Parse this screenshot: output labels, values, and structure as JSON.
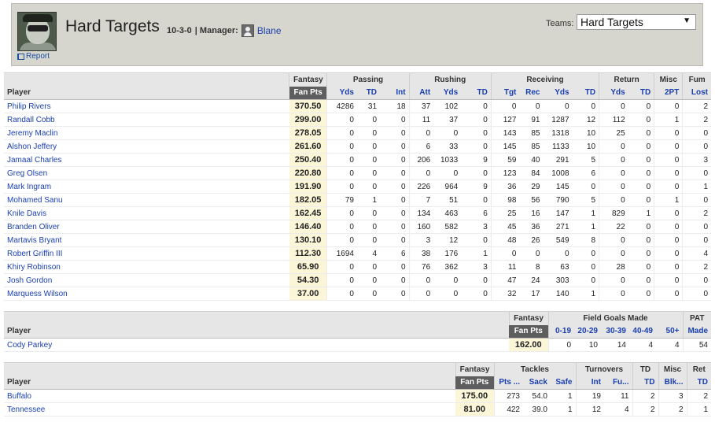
{
  "header": {
    "team_name": "Hard Targets",
    "record": "10-3-0",
    "manager_label": "| Manager:",
    "manager_name": "Blane",
    "report_label": "Report",
    "teams_label": "Teams:",
    "teams_selected": "Hard Targets",
    "dropdown_arrow": "▼"
  },
  "offense": {
    "groups": [
      "Fantasy",
      "Passing",
      "Rushing",
      "Receiving",
      "Return",
      "Misc",
      "Fum"
    ],
    "columns": [
      "Player",
      "Fan Pts",
      "Yds",
      "TD",
      "Int",
      "Att",
      "Yds",
      "TD",
      "Tgt",
      "Rec",
      "Yds",
      "TD",
      "Yds",
      "TD",
      "2PT",
      "Lost"
    ],
    "rows": [
      [
        "Philip Rivers",
        "370.50",
        "4286",
        "31",
        "18",
        "37",
        "102",
        "0",
        "0",
        "0",
        "0",
        "0",
        "0",
        "0",
        "0",
        "2"
      ],
      [
        "Randall Cobb",
        "299.00",
        "0",
        "0",
        "0",
        "11",
        "37",
        "0",
        "127",
        "91",
        "1287",
        "12",
        "112",
        "0",
        "1",
        "2"
      ],
      [
        "Jeremy Maclin",
        "278.05",
        "0",
        "0",
        "0",
        "0",
        "0",
        "0",
        "143",
        "85",
        "1318",
        "10",
        "25",
        "0",
        "0",
        "0"
      ],
      [
        "Alshon Jeffery",
        "261.60",
        "0",
        "0",
        "0",
        "6",
        "33",
        "0",
        "145",
        "85",
        "1133",
        "10",
        "0",
        "0",
        "0",
        "0"
      ],
      [
        "Jamaal Charles",
        "250.40",
        "0",
        "0",
        "0",
        "206",
        "1033",
        "9",
        "59",
        "40",
        "291",
        "5",
        "0",
        "0",
        "0",
        "3"
      ],
      [
        "Greg Olsen",
        "220.80",
        "0",
        "0",
        "0",
        "0",
        "0",
        "0",
        "123",
        "84",
        "1008",
        "6",
        "0",
        "0",
        "0",
        "0"
      ],
      [
        "Mark Ingram",
        "191.90",
        "0",
        "0",
        "0",
        "226",
        "964",
        "9",
        "36",
        "29",
        "145",
        "0",
        "0",
        "0",
        "0",
        "1"
      ],
      [
        "Mohamed Sanu",
        "182.05",
        "79",
        "1",
        "0",
        "7",
        "51",
        "0",
        "98",
        "56",
        "790",
        "5",
        "0",
        "0",
        "1",
        "0"
      ],
      [
        "Knile Davis",
        "162.45",
        "0",
        "0",
        "0",
        "134",
        "463",
        "6",
        "25",
        "16",
        "147",
        "1",
        "829",
        "1",
        "0",
        "2"
      ],
      [
        "Branden Oliver",
        "146.40",
        "0",
        "0",
        "0",
        "160",
        "582",
        "3",
        "45",
        "36",
        "271",
        "1",
        "22",
        "0",
        "0",
        "0"
      ],
      [
        "Martavis Bryant",
        "130.10",
        "0",
        "0",
        "0",
        "3",
        "12",
        "0",
        "48",
        "26",
        "549",
        "8",
        "0",
        "0",
        "0",
        "0"
      ],
      [
        "Robert Griffin III",
        "112.30",
        "1694",
        "4",
        "6",
        "38",
        "176",
        "1",
        "0",
        "0",
        "0",
        "0",
        "0",
        "0",
        "0",
        "4"
      ],
      [
        "Khiry Robinson",
        "65.90",
        "0",
        "0",
        "0",
        "76",
        "362",
        "3",
        "11",
        "8",
        "63",
        "0",
        "28",
        "0",
        "0",
        "2"
      ],
      [
        "Josh Gordon",
        "54.30",
        "0",
        "0",
        "0",
        "0",
        "0",
        "0",
        "47",
        "24",
        "303",
        "0",
        "0",
        "0",
        "0",
        "0"
      ],
      [
        "Marquess Wilson",
        "37.00",
        "0",
        "0",
        "0",
        "0",
        "0",
        "0",
        "32",
        "17",
        "140",
        "1",
        "0",
        "0",
        "0",
        "0"
      ]
    ]
  },
  "kicker": {
    "groups": [
      "Fantasy",
      "Field Goals Made",
      "PAT"
    ],
    "columns": [
      "Player",
      "Fan Pts",
      "0-19",
      "20-29",
      "30-39",
      "40-49",
      "50+",
      "Made"
    ],
    "rows": [
      [
        "Cody Parkey",
        "162.00",
        "0",
        "10",
        "14",
        "4",
        "4",
        "54"
      ]
    ]
  },
  "defense": {
    "groups": [
      "Fantasy",
      "Tackles",
      "Turnovers",
      "TD",
      "Misc",
      "Ret"
    ],
    "columns": [
      "Player",
      "Fan Pts",
      "Pts ...",
      "Sack",
      "Safe",
      "Int",
      "Fu...",
      "TD",
      "Blk...",
      "TD"
    ],
    "rows": [
      [
        "Buffalo",
        "175.00",
        "273",
        "54.0",
        "1",
        "19",
        "11",
        "2",
        "3",
        "2"
      ],
      [
        "Tennessee",
        "81.00",
        "422",
        "39.0",
        "1",
        "12",
        "4",
        "2",
        "2",
        "1"
      ]
    ]
  }
}
